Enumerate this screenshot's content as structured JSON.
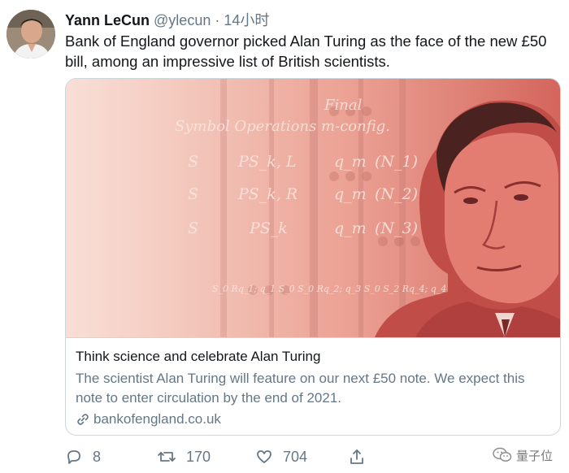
{
  "tweet": {
    "author_name": "Yann LeCun",
    "author_handle": "@ylecun",
    "separator": "·",
    "timestamp": "14小时",
    "text": "Bank of England governor picked Alan Turing as the face of the new £50 bill, among an impressive list of British scientists."
  },
  "card": {
    "image_overlay": {
      "heading_1": "Final",
      "heading_2": "Symbol  Operations  m-config.",
      "rows": [
        {
          "sym": "S",
          "op": "PS_k, L",
          "config": "q_m",
          "n": "(N_1)"
        },
        {
          "sym": "S",
          "op": "PS_k, R",
          "config": "q_m",
          "n": "(N_2)"
        },
        {
          "sym": "S",
          "op": "PS_k",
          "config": "q_m",
          "n": "(N_3)"
        }
      ],
      "bottom_line": "S_0 Rq_1; q_1 S_0 S_0 Rq_2; q_3 S_0 S_2 Rq_4; q_4 S_0 S_0 Rq_1;.",
      "colors": {
        "tint_left": "#f1b9a9",
        "tint_right": "#d9685e"
      }
    },
    "title": "Think science and celebrate Alan Turing",
    "description": "The scientist Alan Turing will feature on our next £50 note. We expect this note to enter circulation by the end of 2021.",
    "domain": "bankofengland.co.uk",
    "domain_icon": "link-icon"
  },
  "actions": {
    "reply_count": "8",
    "retweet_count": "170",
    "like_count": "704",
    "reply_icon": "reply-icon",
    "retweet_icon": "retweet-icon",
    "like_icon": "heart-icon",
    "share_icon": "share-icon"
  },
  "watermark": {
    "text": "量子位",
    "icon": "wechat-icon"
  }
}
